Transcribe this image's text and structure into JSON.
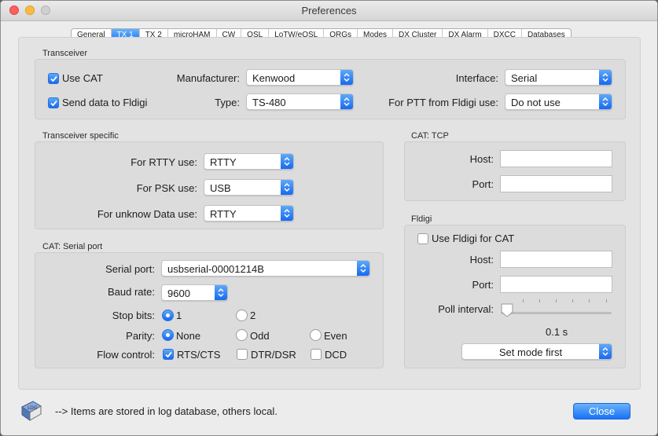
{
  "window": {
    "title": "Preferences"
  },
  "tabs": [
    "General",
    "TX 1",
    "TX 2",
    "microHAM",
    "CW",
    "QSL",
    "LoTW/eQSL",
    "QRGs",
    "Modes",
    "DX Cluster",
    "DX Alarm",
    "DXCC",
    "Databases"
  ],
  "active_tab": "TX 1",
  "transceiver": {
    "group_label": "Transceiver",
    "use_cat": {
      "label": "Use CAT",
      "checked": true
    },
    "send_data": {
      "label": "Send data to Fldigi",
      "checked": true
    },
    "manufacturer_label": "Manufacturer:",
    "manufacturer_value": "Kenwood",
    "type_label": "Type:",
    "type_value": "TS-480",
    "interface_label": "Interface:",
    "interface_value": "Serial",
    "ptt_label": "For PTT from Fldigi use:",
    "ptt_value": "Do not use"
  },
  "specific": {
    "group_label": "Transceiver specific",
    "rtty_label": "For RTTY use:",
    "rtty_value": "RTTY",
    "psk_label": "For PSK use:",
    "psk_value": "USB",
    "unknown_label": "For unknow Data use:",
    "unknown_value": "RTTY"
  },
  "serial": {
    "group_label": "CAT: Serial port",
    "port_label": "Serial port:",
    "port_value": "usbserial-00001214B",
    "baud_label": "Baud rate:",
    "baud_value": "9600",
    "stop_label": "Stop bits:",
    "stop_options": [
      "1",
      "2"
    ],
    "stop_selected": "1",
    "parity_label": "Parity:",
    "parity_options": [
      "None",
      "Odd",
      "Even"
    ],
    "parity_selected": "None",
    "flow_label": "Flow control:",
    "flow_options": [
      {
        "label": "RTS/CTS",
        "checked": true
      },
      {
        "label": "DTR/DSR",
        "checked": false
      },
      {
        "label": "DCD",
        "checked": false
      }
    ]
  },
  "tcp": {
    "group_label": "CAT: TCP",
    "host_label": "Host:",
    "host_value": "",
    "port_label": "Port:",
    "port_value": ""
  },
  "fldigi": {
    "group_label": "Fldigi",
    "use_label": "Use Fldigi for CAT",
    "use_checked": false,
    "host_label": "Host:",
    "host_value": "",
    "port_label": "Port:",
    "port_value": "",
    "poll_label": "Poll interval:",
    "poll_value": "0.1 s",
    "poll_fraction": 0.0,
    "mode_value": "Set mode first"
  },
  "footer": {
    "note": "--> Items are stored in log database, others local.",
    "close_label": "Close"
  },
  "colors": {
    "accent": "#1a7cf6",
    "window_bg": "#ececec"
  }
}
